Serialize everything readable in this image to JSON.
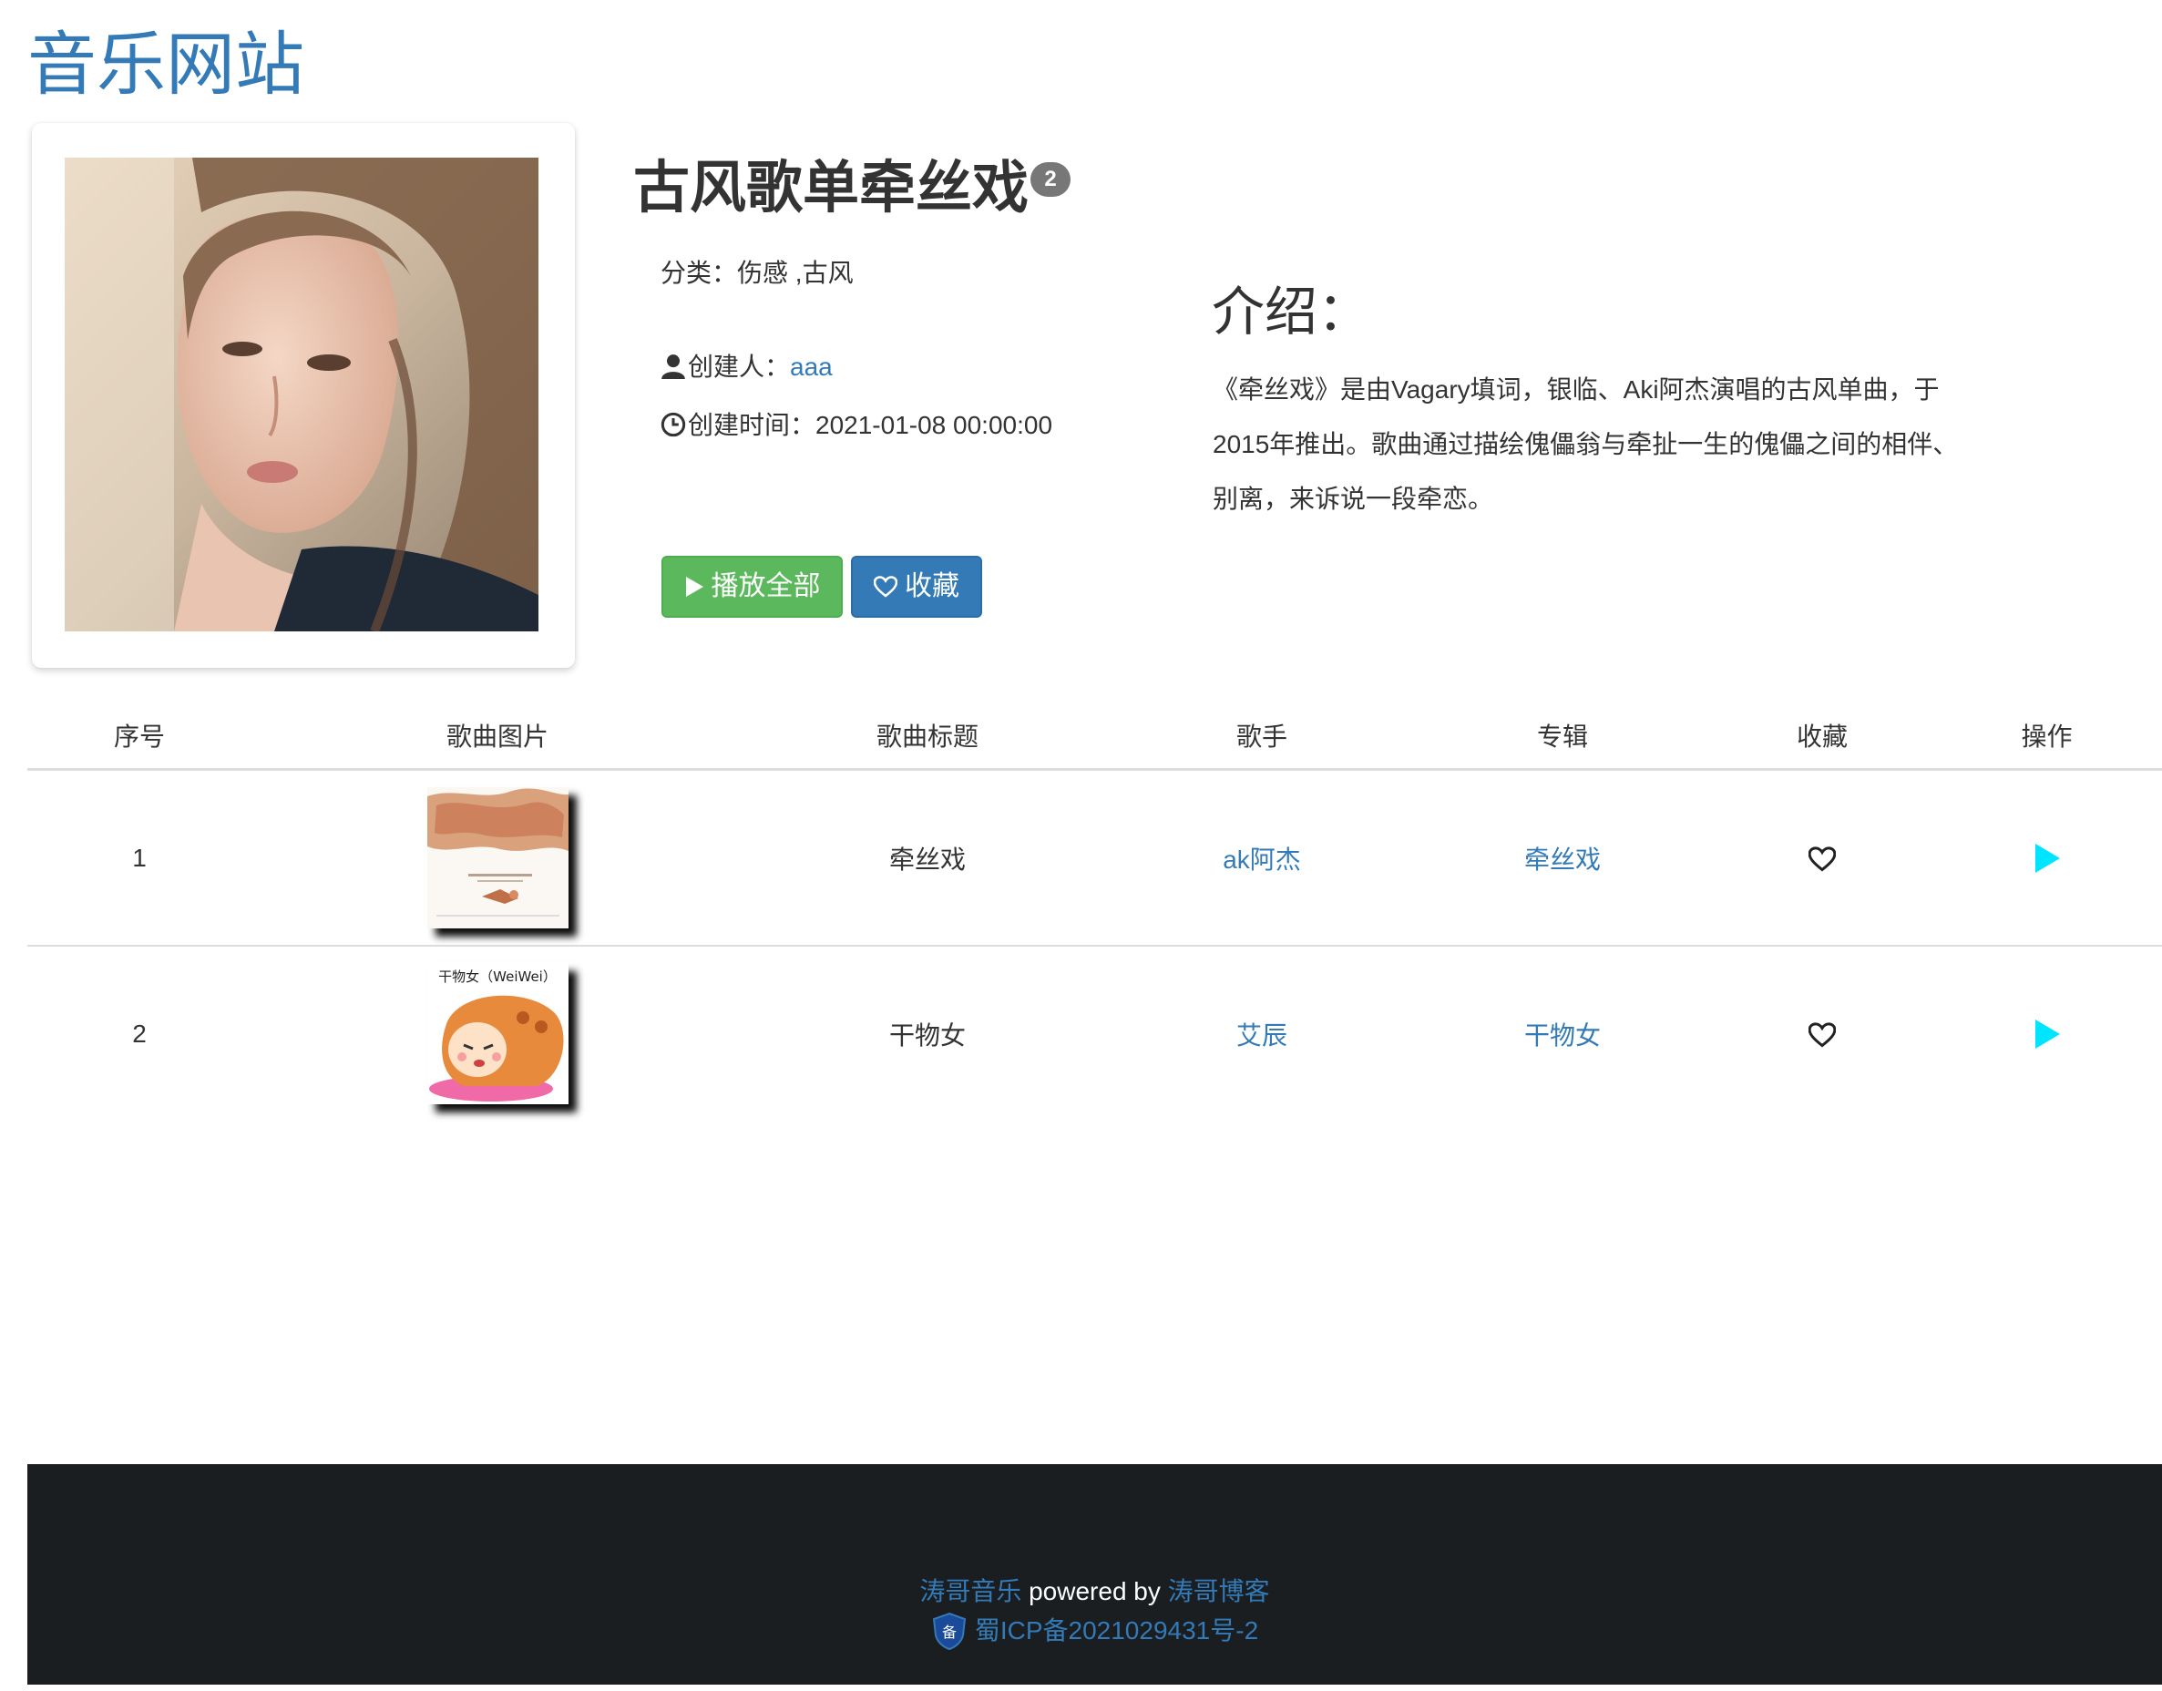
{
  "site": {
    "title": "音乐网站"
  },
  "playlist": {
    "title": "古风歌单牵丝戏",
    "count": "2",
    "category_label": "分类：",
    "category_value": "伤感 ,古风",
    "creator_label": "创建人：",
    "creator": "aaa",
    "created_label": "创建时间：",
    "created_time": "2021-01-08 00:00:00"
  },
  "buttons": {
    "play_all": "播放全部",
    "favorite": "收藏"
  },
  "intro": {
    "heading": "介绍：",
    "text": "《牵丝戏》是由Vagary填词，银临、Aki阿杰演唱的古风单曲，于2015年推出。歌曲通过描绘傀儡翁与牵扯一生的傀儡之间的相伴、别离，来诉说一段牵恋。"
  },
  "table": {
    "headers": [
      "序号",
      "歌曲图片",
      "歌曲标题",
      "歌手",
      "专辑",
      "收藏",
      "操作"
    ],
    "rows": [
      {
        "num": "1",
        "title": "牵丝戏",
        "singer": "ak阿杰",
        "album": "牵丝戏"
      },
      {
        "num": "2",
        "title": "干物女",
        "singer": "艾辰",
        "album": "干物女",
        "thumb_caption": "干物女（WeiWei）"
      }
    ]
  },
  "footer": {
    "brand": "涛哥音乐",
    "powered": " powered by ",
    "blog": "涛哥博客",
    "icp": "蜀ICP备2021029431号-2"
  },
  "colors": {
    "link": "#337ab7",
    "play_button": "#5cb85c",
    "fav_button": "#337ab7",
    "play_icon": "#00e5ff",
    "footer_bg": "#1a1e21",
    "badge": "#777777"
  },
  "icons": [
    "user-icon",
    "clock-icon",
    "play-icon",
    "heart-icon",
    "police-badge-icon"
  ]
}
